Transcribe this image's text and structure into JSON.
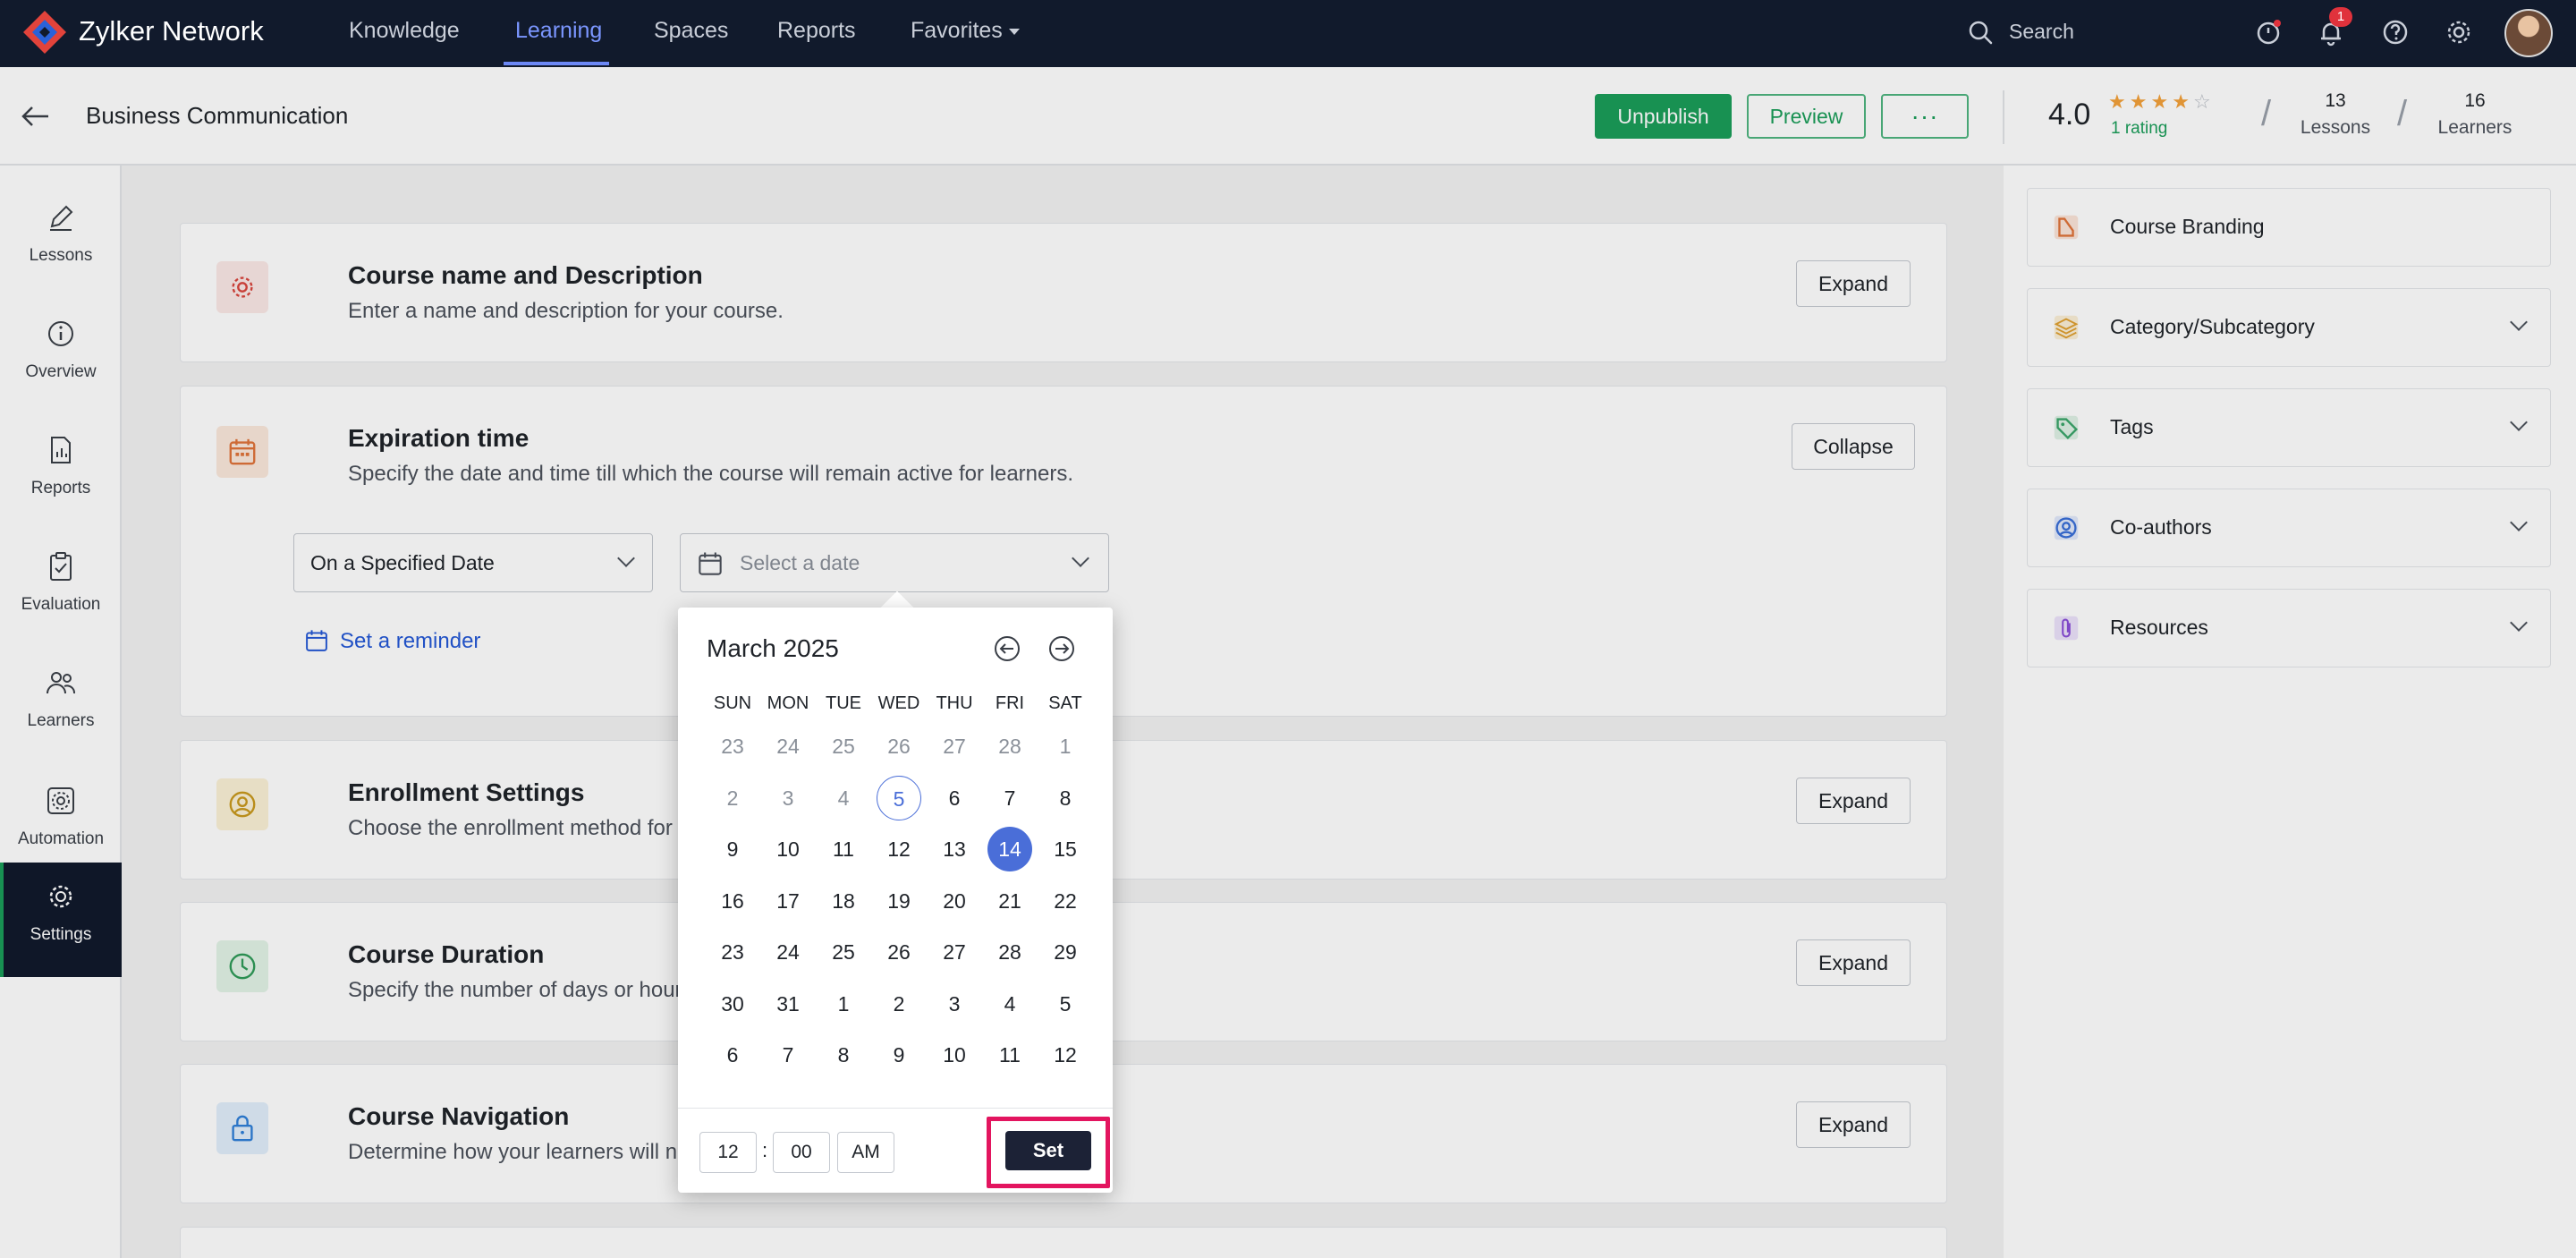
{
  "nav": {
    "brand": "Zylker Network",
    "links": [
      {
        "label": "Knowledge",
        "active": false
      },
      {
        "label": "Learning",
        "active": true
      },
      {
        "label": "Spaces",
        "active": false
      },
      {
        "label": "Reports",
        "active": false
      },
      {
        "label": "Favorites",
        "active": false
      }
    ],
    "search_label": "Search",
    "notification_count": "1"
  },
  "header": {
    "title": "Business Communication",
    "unpublish_label": "Unpublish",
    "preview_label": "Preview",
    "more_label": "···",
    "rating_value": "4.0",
    "rating_stars": 4,
    "rating_count": "1 rating",
    "lessons_count": "13",
    "lessons_label": "Lessons",
    "learners_count": "16",
    "learners_label": "Learners"
  },
  "sidebar": {
    "items": [
      {
        "label": "Lessons",
        "icon": "pencil-icon"
      },
      {
        "label": "Overview",
        "icon": "info-icon"
      },
      {
        "label": "Reports",
        "icon": "report-icon"
      },
      {
        "label": "Evaluation",
        "icon": "clipboard-icon"
      },
      {
        "label": "Learners",
        "icon": "users-icon"
      },
      {
        "label": "Automation",
        "icon": "automation-gear-icon"
      },
      {
        "label": "Settings",
        "icon": "gear-icon",
        "active": true
      }
    ]
  },
  "sections": {
    "course_name": {
      "title": "Course name and Description",
      "desc": "Enter a name and description for your course.",
      "action": "Expand"
    },
    "expiration": {
      "title": "Expiration time",
      "desc": "Specify the date and time till which the course will remain active for learners.",
      "action": "Collapse",
      "mode": "On a Specified Date",
      "date_placeholder": "Select a date",
      "reminder_label": "Set a reminder"
    },
    "enrollment": {
      "title": "Enrollment Settings",
      "desc": "Choose the enrollment method for your c",
      "action": "Expand"
    },
    "duration": {
      "title": "Course Duration",
      "desc": "Specify the number of days or hours a lea",
      "action": "Expand"
    },
    "navigation": {
      "title": "Course Navigation",
      "desc": "Determine how your learners will navigat",
      "action": "Expand"
    }
  },
  "right_panel": {
    "items": [
      {
        "label": "Course Branding",
        "icon": "branding-icon",
        "color": "#e0733a",
        "expandable": false
      },
      {
        "label": "Category/Subcategory",
        "icon": "layers-icon",
        "color": "#e0a030",
        "expandable": true
      },
      {
        "label": "Tags",
        "icon": "tag-icon",
        "color": "#3aa56a",
        "expandable": true
      },
      {
        "label": "Co-authors",
        "icon": "user-circle-icon",
        "color": "#3a6fd8",
        "expandable": true
      },
      {
        "label": "Resources",
        "icon": "paperclip-icon",
        "color": "#8a4fd8",
        "expandable": true
      }
    ]
  },
  "calendar": {
    "month_label": "March 2025",
    "weekdays": [
      "SUN",
      "MON",
      "TUE",
      "WED",
      "THU",
      "FRI",
      "SAT"
    ],
    "weeks": [
      [
        {
          "d": "23",
          "m": 1
        },
        {
          "d": "24",
          "m": 1
        },
        {
          "d": "25",
          "m": 1
        },
        {
          "d": "26",
          "m": 1
        },
        {
          "d": "27",
          "m": 1
        },
        {
          "d": "28",
          "m": 1
        },
        {
          "d": "1",
          "m": 1
        }
      ],
      [
        {
          "d": "2",
          "m": 1
        },
        {
          "d": "3",
          "m": 1
        },
        {
          "d": "4",
          "m": 1
        },
        {
          "d": "5",
          "t": 1
        },
        {
          "d": "6"
        },
        {
          "d": "7"
        },
        {
          "d": "8"
        }
      ],
      [
        {
          "d": "9"
        },
        {
          "d": "10"
        },
        {
          "d": "11"
        },
        {
          "d": "12"
        },
        {
          "d": "13"
        },
        {
          "d": "14",
          "s": 1
        },
        {
          "d": "15"
        }
      ],
      [
        {
          "d": "16"
        },
        {
          "d": "17"
        },
        {
          "d": "18"
        },
        {
          "d": "19"
        },
        {
          "d": "20"
        },
        {
          "d": "21"
        },
        {
          "d": "22"
        }
      ],
      [
        {
          "d": "23"
        },
        {
          "d": "24"
        },
        {
          "d": "25"
        },
        {
          "d": "26"
        },
        {
          "d": "27"
        },
        {
          "d": "28"
        },
        {
          "d": "29"
        }
      ],
      [
        {
          "d": "30"
        },
        {
          "d": "31"
        },
        {
          "d": "1"
        },
        {
          "d": "2"
        },
        {
          "d": "3"
        },
        {
          "d": "4"
        },
        {
          "d": "5"
        }
      ],
      [
        {
          "d": "6"
        },
        {
          "d": "7"
        },
        {
          "d": "8"
        },
        {
          "d": "9"
        },
        {
          "d": "10"
        },
        {
          "d": "11"
        },
        {
          "d": "12"
        }
      ]
    ],
    "hour": "12",
    "minute": "00",
    "meridiem": "AM",
    "set_label": "Set"
  },
  "colors": {
    "nav_bg": "#111a2c",
    "accent_green": "#1b9e5a",
    "accent_blue": "#4a6ed8",
    "highlight": "#e3155f"
  }
}
